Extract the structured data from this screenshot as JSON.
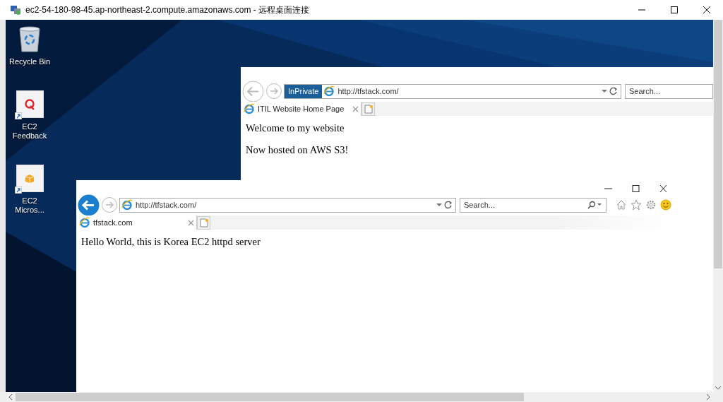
{
  "window": {
    "title": "ec2-54-180-98-45.ap-northeast-2.compute.amazonaws.com - 远程桌面连接"
  },
  "desktop_icons": [
    {
      "label": "Recycle Bin",
      "kind": "recycle"
    },
    {
      "label": "EC2 Feedback",
      "kind": "feedback"
    },
    {
      "label": "EC2 Micros...",
      "kind": "package"
    }
  ],
  "browsers": [
    {
      "kind": "background",
      "private_badge": "InPrivate",
      "address": "http://tfstack.com/",
      "search_placeholder": "Search...",
      "tabs": [
        {
          "label": "ITIL Website Home Page",
          "selected": true
        }
      ],
      "paragraphs": [
        "Welcome to my website",
        "Now hosted on AWS S3!"
      ]
    },
    {
      "kind": "foreground",
      "address": "http://tfstack.com/",
      "search_placeholder": "Search...",
      "tabs": [
        {
          "label": "tfstack.com",
          "selected": true
        }
      ],
      "paragraphs": [
        "Hello World, this is Korea EC2 httpd server"
      ]
    }
  ]
}
